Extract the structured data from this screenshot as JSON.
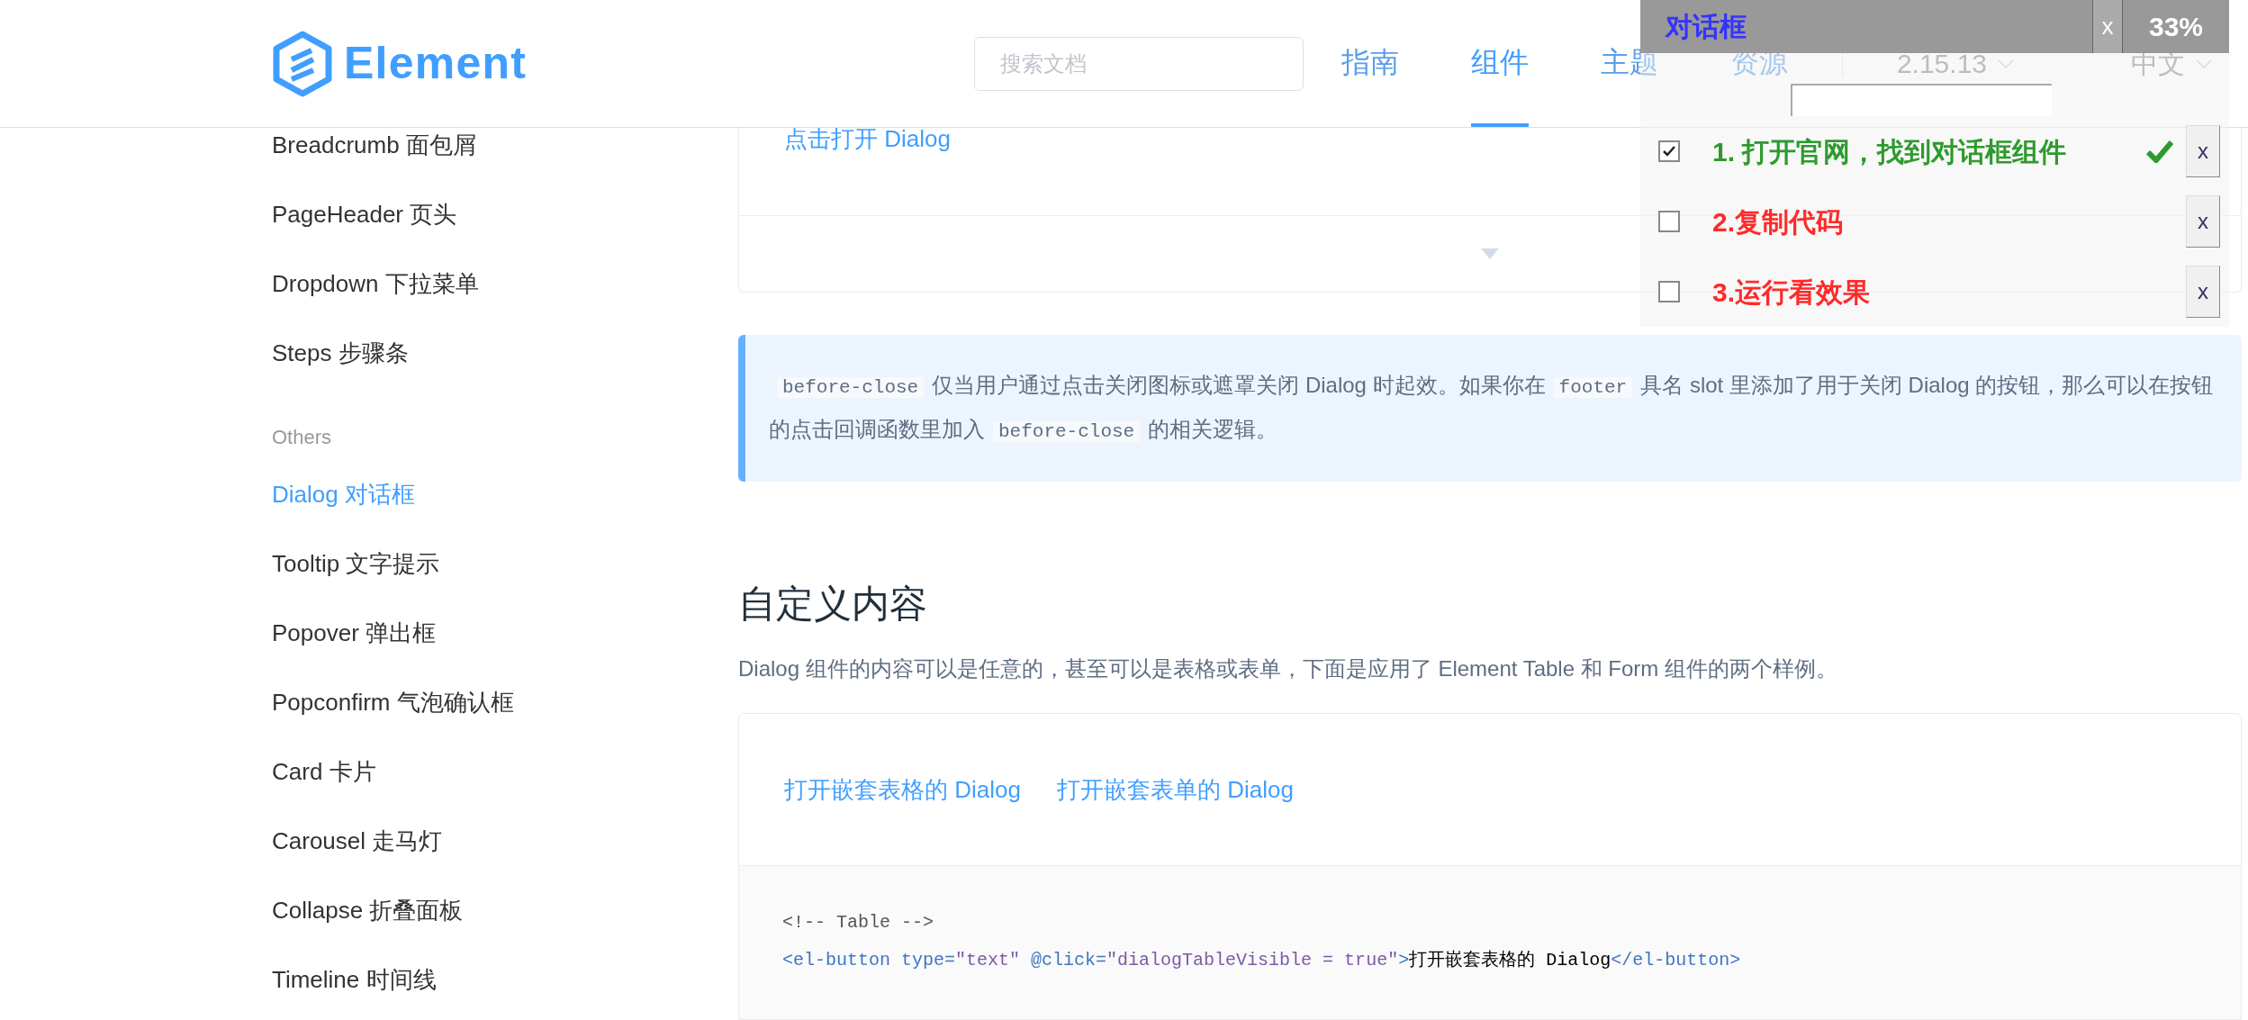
{
  "header": {
    "logo": "Element",
    "search": {
      "placeholder": "搜索文档"
    },
    "nav": [
      {
        "label": "指南",
        "selected": false
      },
      {
        "label": "组件",
        "selected": true
      },
      {
        "label": "主题",
        "selected": false
      },
      {
        "label": "资源",
        "selected": false
      }
    ],
    "version": "2.15.13",
    "language": "中文"
  },
  "sidebar": {
    "items": [
      {
        "kind": "item",
        "label": "Breadcrumb 面包屑",
        "selected": false
      },
      {
        "kind": "item",
        "label": "PageHeader 页头",
        "selected": false
      },
      {
        "kind": "item",
        "label": "Dropdown 下拉菜单",
        "selected": false
      },
      {
        "kind": "item",
        "label": "Steps 步骤条",
        "selected": false
      },
      {
        "kind": "group",
        "label": "Others"
      },
      {
        "kind": "item",
        "label": "Dialog 对话框",
        "selected": true
      },
      {
        "kind": "item",
        "label": "Tooltip 文字提示",
        "selected": false
      },
      {
        "kind": "item",
        "label": "Popover 弹出框",
        "selected": false
      },
      {
        "kind": "item",
        "label": "Popconfirm 气泡确认框",
        "selected": false
      },
      {
        "kind": "item",
        "label": "Card 卡片",
        "selected": false
      },
      {
        "kind": "item",
        "label": "Carousel 走马灯",
        "selected": false
      },
      {
        "kind": "item",
        "label": "Collapse 折叠面板",
        "selected": false
      },
      {
        "kind": "item",
        "label": "Timeline 时间线",
        "selected": false
      }
    ]
  },
  "content": {
    "demo_link": "点击打开 Dialog",
    "tip": [
      {
        "kind": "code",
        "text": "before-close"
      },
      {
        "kind": "text",
        "text": "仅当用户通过点击关闭图标或遮罩关闭 Dialog 时起效。如果你在"
      },
      {
        "kind": "code",
        "text": "footer"
      },
      {
        "kind": "text",
        "text": "具名 slot 里添加了用于关闭 Dialog 的按钮，那么可以在按钮的点击回调函数里加入"
      },
      {
        "kind": "code",
        "text": "before-close"
      },
      {
        "kind": "text",
        "text": "的相关逻辑。"
      }
    ],
    "heading": "自定义内容",
    "paragraph": "Dialog 组件的内容可以是任意的，甚至可以是表格或表单，下面是应用了 Element Table 和 Form 组件的两个样例。",
    "demo_buttons": [
      "打开嵌套表格的 Dialog",
      "打开嵌套表单的 Dialog"
    ],
    "code_lines": [
      [
        {
          "kind": "comment",
          "text": "<!-- Table -->"
        }
      ],
      [
        {
          "kind": "tag",
          "text": "<el-button"
        },
        {
          "kind": "attr",
          "text": " type="
        },
        {
          "kind": "string",
          "text": "\"text\""
        },
        {
          "kind": "attr",
          "text": " @click="
        },
        {
          "kind": "string",
          "text": "\"dialogTableVisible = true\""
        },
        {
          "kind": "tag",
          "text": ">"
        },
        {
          "kind": "text",
          "text": "打开嵌套表格的 Dialog"
        },
        {
          "kind": "tag",
          "text": "</el-button>"
        }
      ]
    ]
  },
  "overlay": {
    "title": "对话框",
    "close": "x",
    "percent": "33%",
    "tasks": [
      {
        "label": "1. 打开官网，找到对话框组件",
        "checked": true,
        "delete": "x"
      },
      {
        "label": "2.复制代码",
        "checked": false,
        "delete": "x"
      },
      {
        "label": "3.运行看效果",
        "checked": false,
        "delete": "x"
      }
    ]
  }
}
